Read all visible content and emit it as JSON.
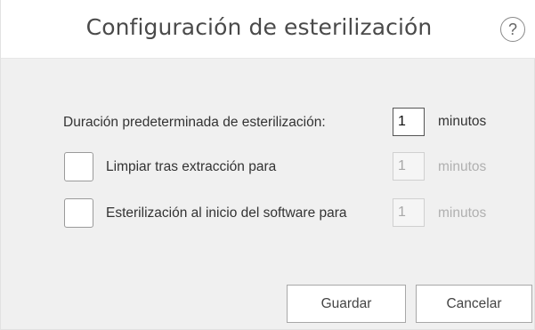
{
  "dialog": {
    "title": "Configuración de esterilización",
    "help_label": "?"
  },
  "settings": {
    "default_duration": {
      "label": "Duración predeterminada de esterilización:",
      "value": "1",
      "unit": "minutos"
    },
    "clean_after_extraction": {
      "label": "Limpiar tras extracción para",
      "checked": false,
      "value": "1",
      "unit": "minutos",
      "enabled": false
    },
    "sterilize_on_startup": {
      "label": "Esterilización al inicio del software para",
      "checked": false,
      "value": "1",
      "unit": "minutos",
      "enabled": false
    }
  },
  "buttons": {
    "save_label": "Guardar",
    "cancel_label": "Cancelar"
  },
  "colors": {
    "dialog_background": "#f0f0f0",
    "titlebar_background": "#ffffff",
    "disabled_text": "#b0b0b0"
  }
}
